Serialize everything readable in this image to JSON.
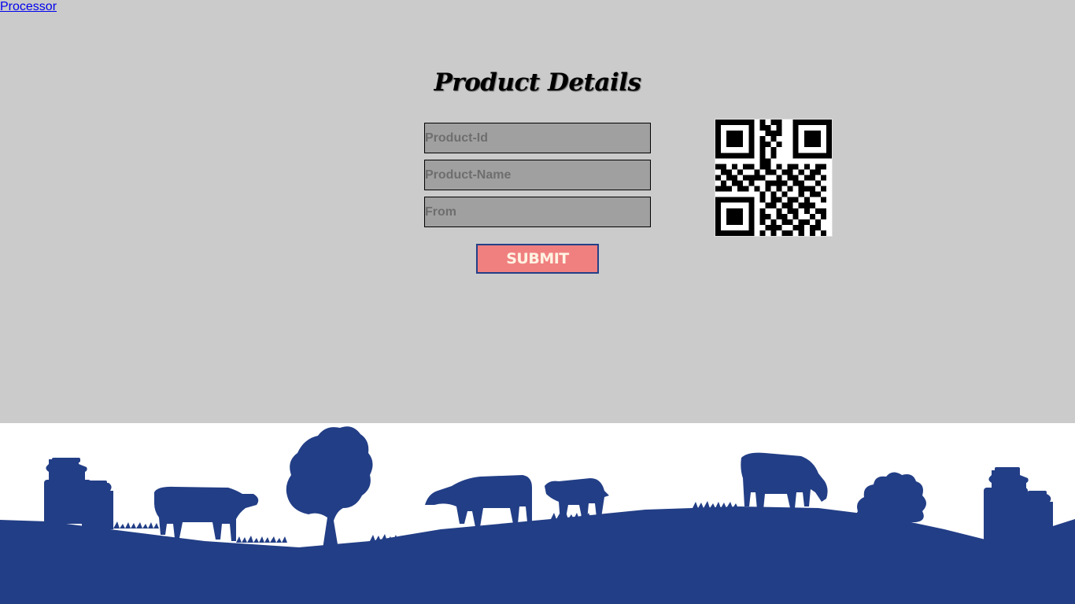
{
  "nav": {
    "link_label": "Processor"
  },
  "form": {
    "title": "Product Details",
    "fields": [
      {
        "placeholder": "Product-Id",
        "value": ""
      },
      {
        "placeholder": "Product-Name",
        "value": ""
      },
      {
        "placeholder": "From",
        "value": ""
      }
    ],
    "submit_label": "SUBMIT"
  },
  "qr_code": {
    "icon": "qr-code"
  },
  "footer_illustration": {
    "icon": "dairy-farm-silhouette",
    "color": "#223e86"
  },
  "colors": {
    "background": "#cbcbcb",
    "field_background": "#a0a0a0",
    "button_background": "#f08080",
    "button_text": "#fff3e2",
    "button_border": "#233f87",
    "link": "#0000ee"
  }
}
